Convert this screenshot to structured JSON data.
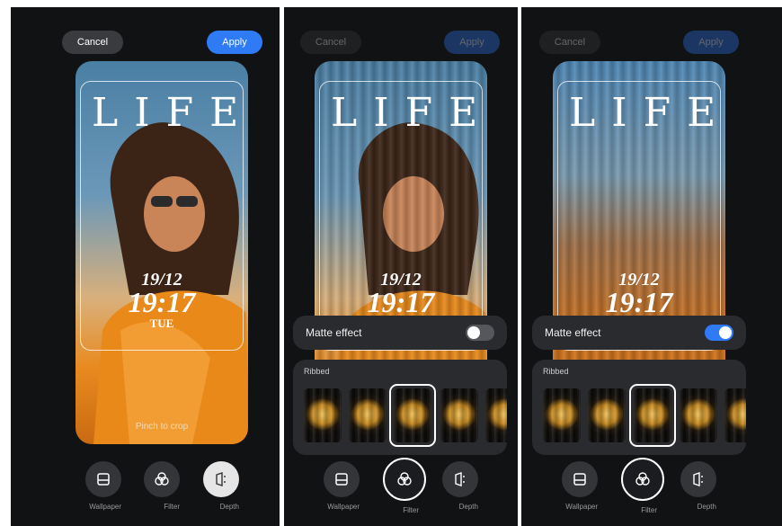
{
  "header": {
    "cancel_label": "Cancel",
    "apply_label": "Apply"
  },
  "preview": {
    "title": "LIFE",
    "clock_date": "19/12",
    "clock_time": "19:17",
    "clock_day": "TUE",
    "pinch_hint": "Pinch to crop"
  },
  "matte": {
    "label": "Matte effect",
    "panel2_enabled": false,
    "panel3_enabled": true
  },
  "filters": {
    "group_label": "Ribbed",
    "thumb_count": 5,
    "selected_index": 2
  },
  "tools": [
    {
      "label": "Wallpaper",
      "icon": "wallpaper-icon"
    },
    {
      "label": "Filter",
      "icon": "filter-icon"
    },
    {
      "label": "Depth",
      "icon": "depth-icon"
    }
  ],
  "colors": {
    "accent": "#2f7bf5",
    "panel_bg": "#111214",
    "card_bg": "#2a2b2e"
  }
}
